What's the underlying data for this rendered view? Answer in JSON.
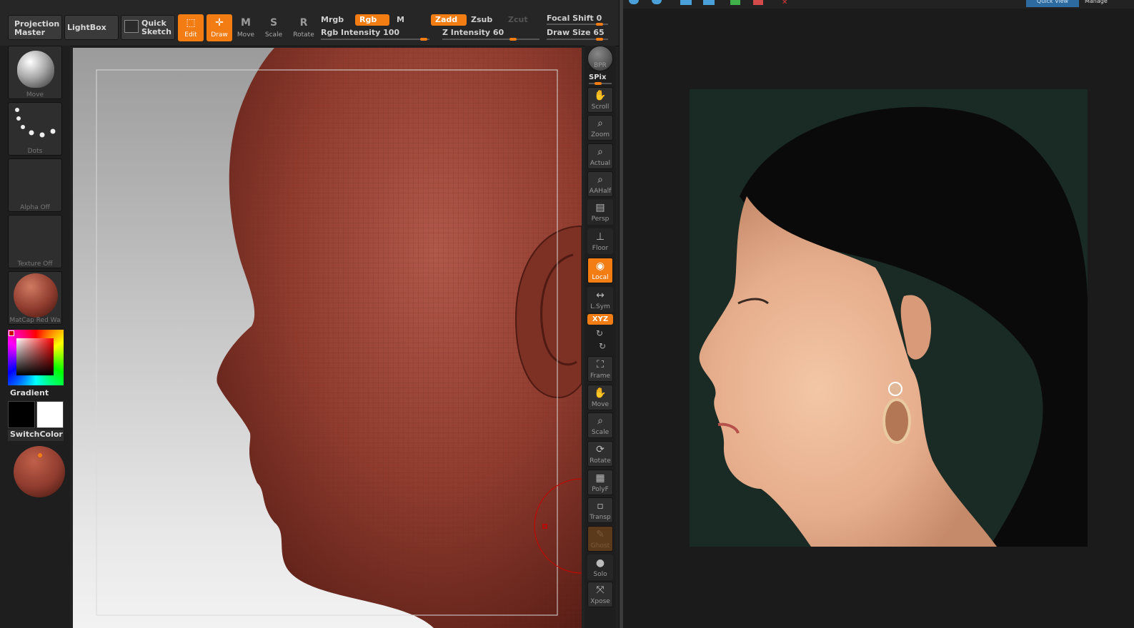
{
  "topbar": {
    "projection_master": "Projection Master",
    "lightbox": "LightBox",
    "quick_sketch": "Quick Sketch",
    "tools": [
      {
        "label": "Edit",
        "active": true
      },
      {
        "label": "Draw",
        "active": true
      },
      {
        "label": "Move",
        "active": false
      },
      {
        "label": "Scale",
        "active": false
      },
      {
        "label": "Rotate",
        "active": false
      }
    ],
    "mrgb": "Mrgb",
    "rgb": "Rgb",
    "m": "M",
    "zadd": "Zadd",
    "zsub": "Zsub",
    "zcut": "Zcut",
    "rgb_intensity": "Rgb Intensity 100",
    "z_intensity": "Z Intensity 60",
    "focal_shift": "Focal Shift 0",
    "draw_size": "Draw Size 65"
  },
  "left_shelf": {
    "brush": "Move",
    "stroke": "Dots",
    "alpha": "Alpha Off",
    "texture": "Texture Off",
    "material": "MatCap Red Wa",
    "gradient": "Gradient",
    "switch_color": "SwitchColor"
  },
  "right_shelf": {
    "bpr": "BPR",
    "spix": "SPix",
    "buttons": [
      "Scroll",
      "Zoom",
      "Actual",
      "AAHalf",
      "Persp",
      "Floor",
      "Local",
      "L.Sym",
      "Frame",
      "Move",
      "Scale",
      "Rotate",
      "PolyF",
      "Transp",
      "Ghost",
      "Solo",
      "Xpose"
    ],
    "xyz": "XYZ"
  },
  "viewer": {
    "quick_view_tab": "Quick View",
    "manage_tab": "Manage"
  },
  "colors": {
    "accent": "#f37c13",
    "clay": "#8e3b2e"
  }
}
